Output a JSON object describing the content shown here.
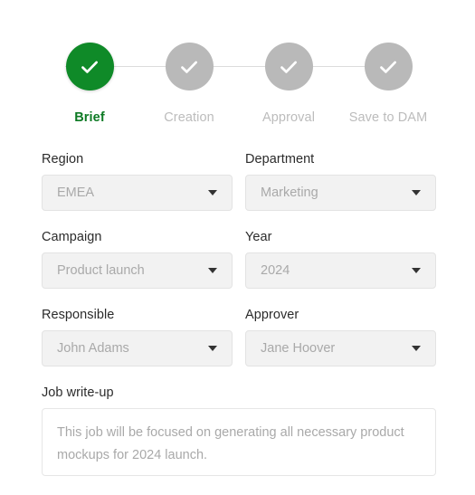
{
  "theme": {
    "accent_green": "#0f8a28",
    "step_done_label": "#0d7a24",
    "step_pending": "#b9b9b9",
    "field_bg": "#f2f2f2",
    "placeholder_text": "#a9a9a9"
  },
  "stepper": {
    "steps": [
      {
        "label": "Brief",
        "state": "done",
        "icon": "check-icon"
      },
      {
        "label": "Creation",
        "state": "pending",
        "icon": "check-icon"
      },
      {
        "label": "Approval",
        "state": "pending",
        "icon": "check-icon"
      },
      {
        "label": "Save to DAM",
        "state": "pending",
        "icon": "check-icon"
      }
    ]
  },
  "form": {
    "fields": {
      "region": {
        "label": "Region",
        "value": "EMEA",
        "icon": "chevron-down-icon"
      },
      "department": {
        "label": "Department",
        "value": "Marketing",
        "icon": "chevron-down-icon"
      },
      "campaign": {
        "label": "Campaign",
        "value": "Product launch",
        "icon": "chevron-down-icon"
      },
      "year": {
        "label": "Year",
        "value": "2024",
        "icon": "chevron-down-icon"
      },
      "responsible": {
        "label": "Responsible",
        "value": "John Adams",
        "icon": "chevron-down-icon"
      },
      "approver": {
        "label": "Approver",
        "value": "Jane Hoover",
        "icon": "chevron-down-icon"
      },
      "job_writeup": {
        "label": "Job write-up",
        "value": "This job will be focused on generating all necessary product mockups for 2024 launch."
      }
    }
  }
}
